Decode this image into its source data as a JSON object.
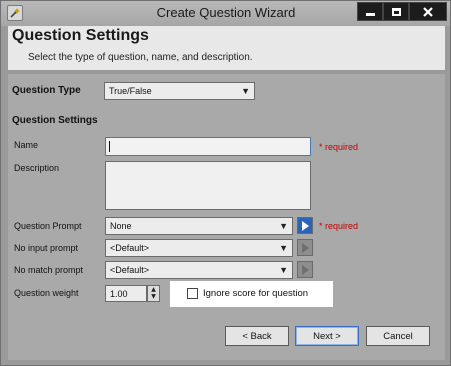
{
  "window": {
    "title": "Create Question Wizard"
  },
  "header": {
    "title": "Question Settings",
    "subtitle": "Select the type of question, name, and description."
  },
  "question_type": {
    "label": "Question Type",
    "value": "True/False"
  },
  "section_title": "Question Settings",
  "fields": {
    "name": {
      "label": "Name",
      "value": "",
      "required": "* required"
    },
    "description": {
      "label": "Description",
      "value": ""
    },
    "question_prompt": {
      "label": "Question Prompt",
      "value": "None",
      "required": "* required"
    },
    "no_input_prompt": {
      "label": "No input prompt",
      "value": "<Default>"
    },
    "no_match_prompt": {
      "label": "No match prompt",
      "value": "<Default>"
    },
    "question_weight": {
      "label": "Question weight",
      "value": "1.00"
    }
  },
  "ignore_score": {
    "label": "Ignore score for question",
    "checked": false
  },
  "buttons": {
    "back": "< Back",
    "next": "Next >",
    "cancel": "Cancel"
  },
  "icons": {
    "app": "wizard-app-icon",
    "minimize": "minimize-icon",
    "maximize": "maximize-icon",
    "close": "close-icon",
    "dropdown": "chevron-down-icon",
    "play": "play-icon"
  },
  "colors": {
    "required": "#c40000",
    "play_active": "#2a64b8",
    "focus_border": "#4a78b0"
  }
}
